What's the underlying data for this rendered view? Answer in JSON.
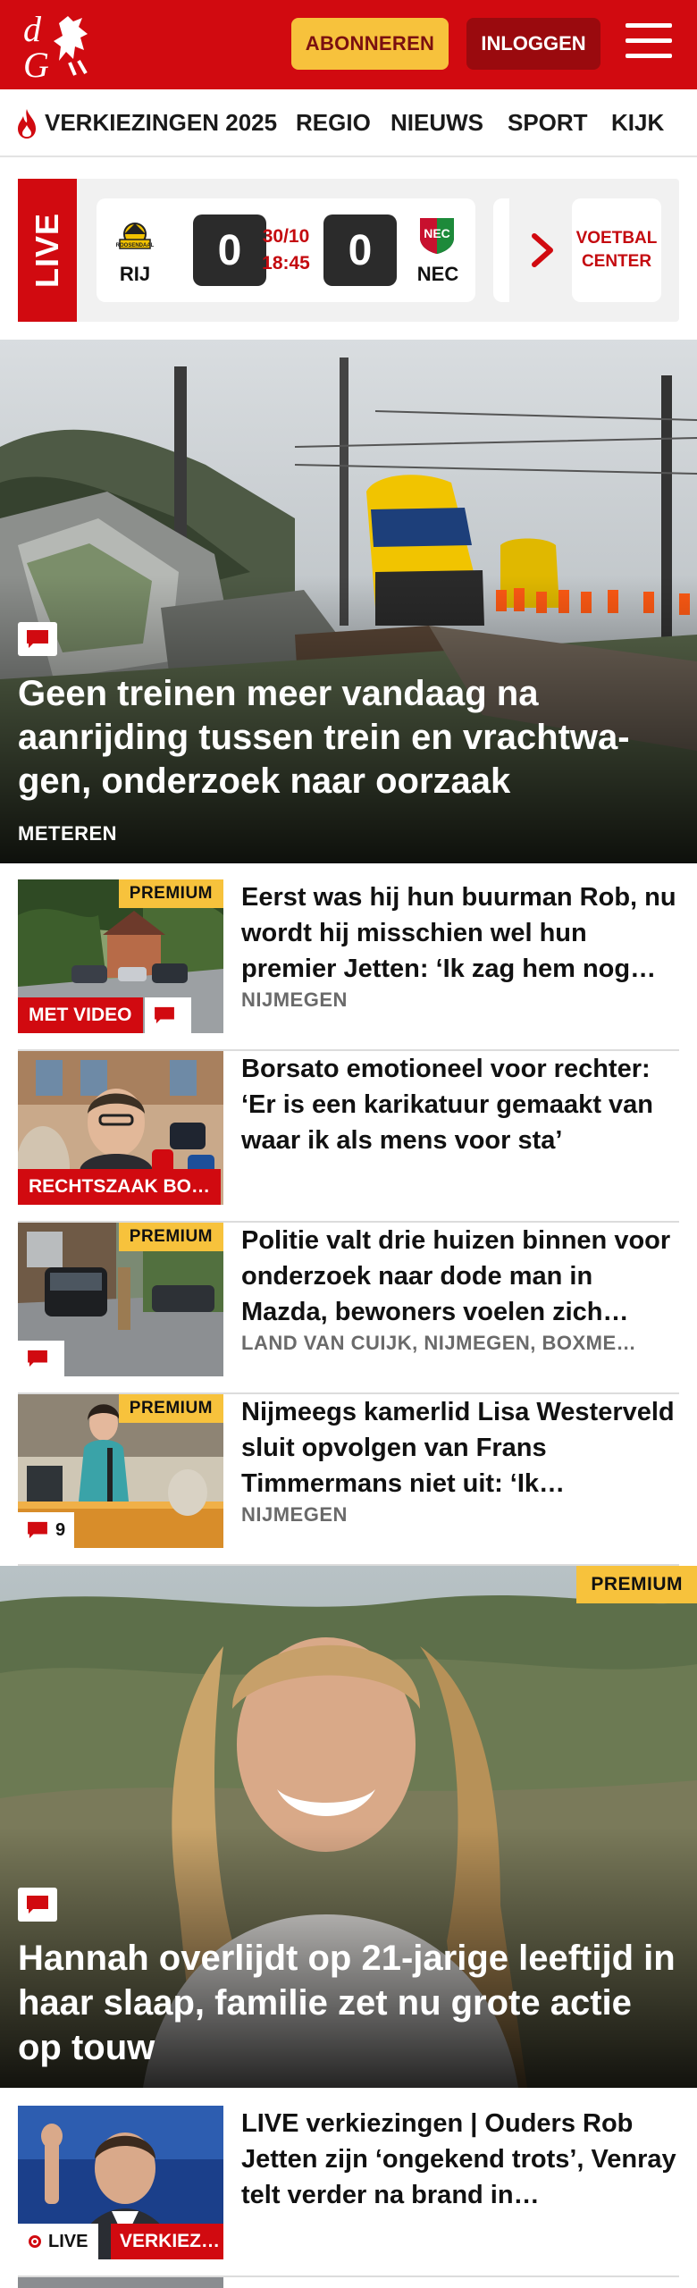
{
  "header": {
    "logo_text": "dG",
    "subscribe_label": "ABONNEREN",
    "login_label": "INLOGGEN"
  },
  "nav": {
    "items": [
      "VERKIEZINGEN 2025",
      "REGIO",
      "NIEUWS",
      "SPORT",
      "KIJK"
    ]
  },
  "live_score": {
    "live_label": "LIVE",
    "home_team": "RIJ",
    "away_team": "NEC",
    "home_score": "0",
    "away_score": "0",
    "date": "30/10",
    "time": "18:45",
    "voetbal_center_label": "VOETBAL CENTER"
  },
  "hero": {
    "title": "Geen treinen meer vandaag na aanrijding tussen trein en vrachtwa-gen, onderzoek naar oorzaak",
    "location": "METEREN"
  },
  "articles": [
    {
      "title": "Eerst was hij hun buurman Rob, nu wordt hij misschien wel hun premier Jetten: ‘Ik zag hem nog…",
      "location": "NIJMEGEN",
      "premium": "PREMIUM",
      "label": "MET VIDEO"
    },
    {
      "title": "Borsato emotioneel voor rechter: ‘Er is een karikatuur gemaakt van waar ik als mens voor sta’",
      "location": "",
      "label": "RECHTSZAAK BO…"
    },
    {
      "title": "Politie valt drie huizen binnen voor onderzoek naar dode man in Mazda, bewoners voelen zich…",
      "location": "LAND VAN CUIJK, NIJMEGEN, BOXME…",
      "premium": "PREMIUM"
    },
    {
      "title": "Nijmeegs kamerlid Lisa Westerveld sluit opvolgen van Frans Timmermans niet uit: ‘Ik…",
      "location": "NIJMEGEN",
      "premium": "PREMIUM",
      "comments": "9"
    }
  ],
  "hero2": {
    "premium": "PREMIUM",
    "title": "Hannah overlijdt op 21-jarige leeftijd in haar slaap, familie zet nu grote actie op touw"
  },
  "live_article": {
    "title": "LIVE verkiezingen | Ouders Rob Jetten zijn ‘ongekend trots’, Venray telt verder na brand in…",
    "live_label": "LIVE",
    "category_label": "VERKIEZ…"
  },
  "colors": {
    "brand_red": "#d10a10",
    "dark_red": "#9a0a0e",
    "premium_yellow": "#f7c23c"
  }
}
